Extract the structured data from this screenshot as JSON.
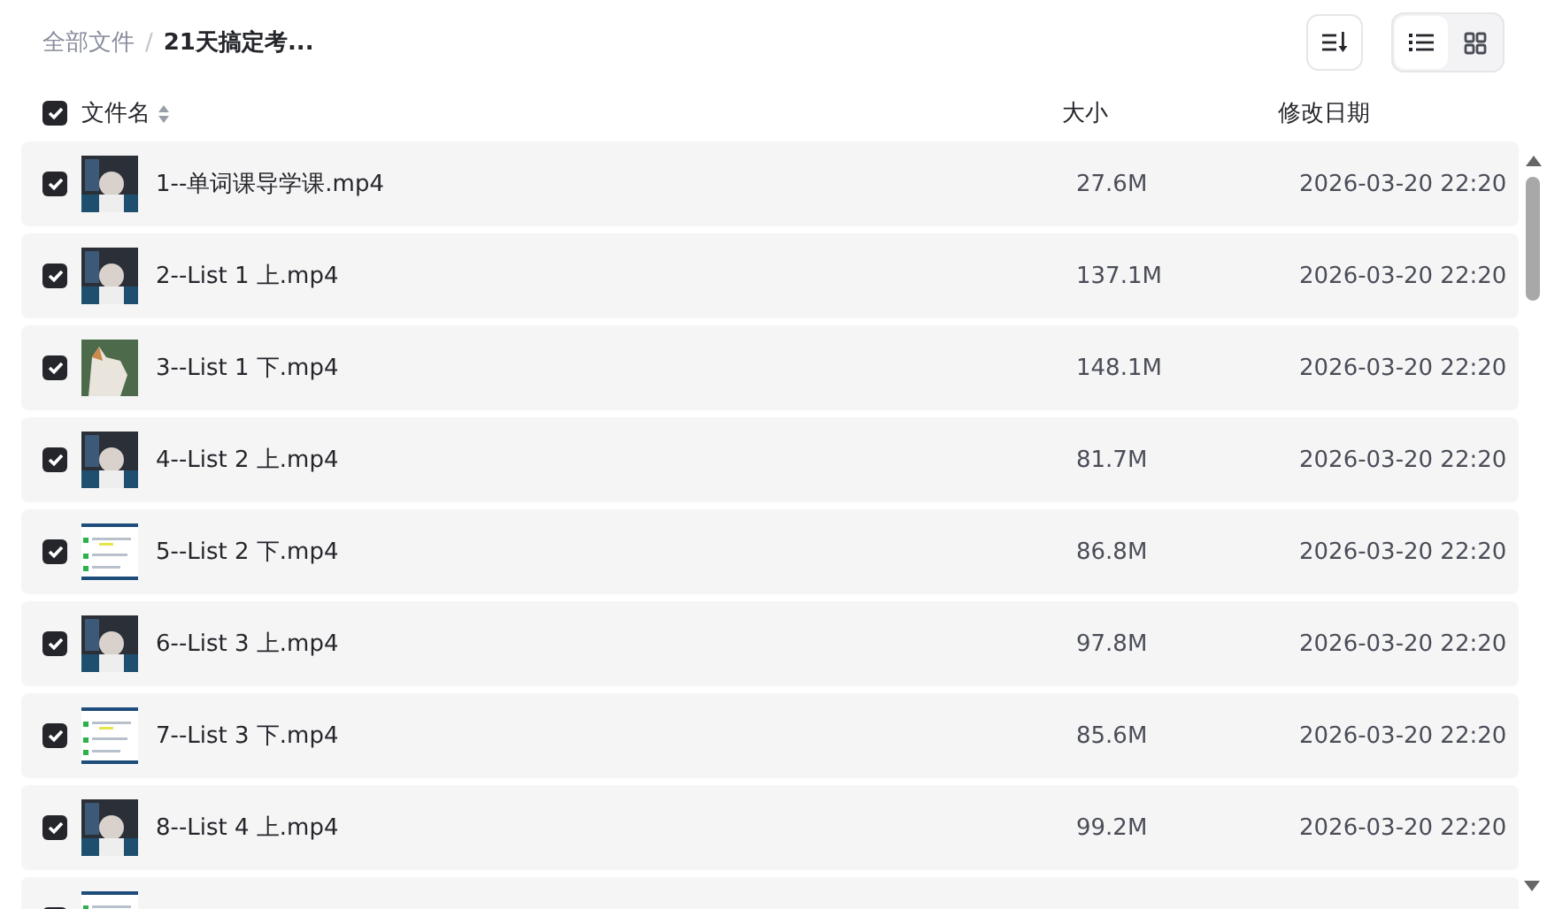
{
  "breadcrumb": [
    {
      "label": "全部文件",
      "current": false
    },
    {
      "label": "21天搞定考...",
      "current": true
    }
  ],
  "breadcrumb_separator": "/",
  "view_modes": [
    {
      "kind": "list",
      "selected": true
    },
    {
      "kind": "grid",
      "selected": false
    }
  ],
  "header": {
    "checked": true,
    "columns": [
      "文件名",
      "大小",
      "修改日期"
    ]
  },
  "files": [
    {
      "checked": true,
      "kind": "video",
      "name": "1--单词课导学课.mp4",
      "size": "27.6M",
      "date": "2026-03-20 22:20"
    },
    {
      "checked": true,
      "kind": "video",
      "name": "2--List 1 上.mp4",
      "size": "137.1M",
      "date": "2026-03-20 22:20"
    },
    {
      "checked": true,
      "kind": "photo",
      "name": "3--List 1 下.mp4",
      "size": "148.1M",
      "date": "2026-03-20 22:20"
    },
    {
      "checked": true,
      "kind": "video",
      "name": "4--List 2 上.mp4",
      "size": "81.7M",
      "date": "2026-03-20 22:20"
    },
    {
      "checked": true,
      "kind": "slides",
      "name": "5--List 2 下.mp4",
      "size": "86.8M",
      "date": "2026-03-20 22:20"
    },
    {
      "checked": true,
      "kind": "video",
      "name": "6--List 3 上.mp4",
      "size": "97.8M",
      "date": "2026-03-20 22:20"
    },
    {
      "checked": true,
      "kind": "slides",
      "name": "7--List 3 下.mp4",
      "size": "85.6M",
      "date": "2026-03-20 22:20"
    },
    {
      "checked": true,
      "kind": "video",
      "name": "8--List 4 上.mp4",
      "size": "99.2M",
      "date": "2026-03-20 22:20"
    },
    {
      "checked": true,
      "kind": "slides"
    }
  ]
}
